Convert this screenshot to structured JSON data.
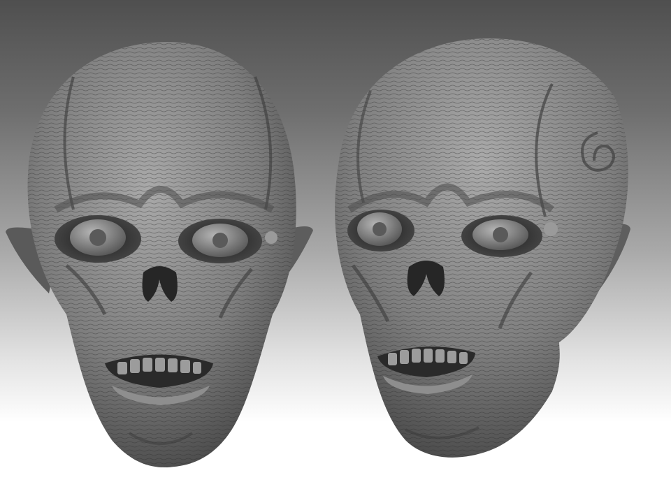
{
  "scene": {
    "subject": "two-sculpted-heads",
    "colors": {
      "background_top": "#4f4f4f",
      "background_bottom": "#ffffff",
      "clay_light": "#a7a7a7",
      "clay_mid": "#7d7d7d",
      "clay_dark": "#3e3e3e"
    }
  }
}
